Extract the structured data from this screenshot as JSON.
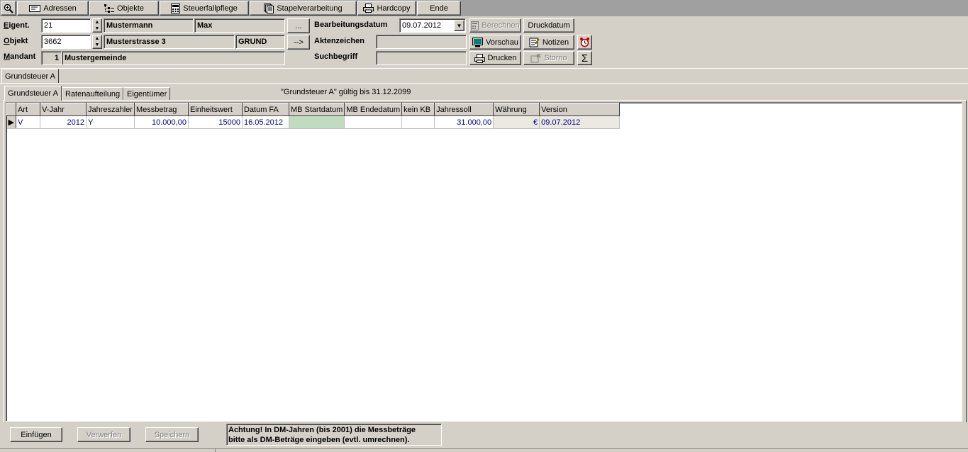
{
  "toolbar": {
    "items": [
      {
        "label": "Adressen",
        "icon": "address-card-icon"
      },
      {
        "label": "Objekte",
        "icon": "tree-list-icon"
      },
      {
        "label": "Steuerfallpflege",
        "icon": "calculator-icon"
      },
      {
        "label": "Stapelverarbeitung",
        "icon": "document-stack-icon"
      },
      {
        "label": "Hardcopy",
        "icon": "printer-icon"
      },
      {
        "label": "Ende",
        "icon": ""
      }
    ],
    "zoom_icon": "magnifier-icon"
  },
  "form": {
    "eigent_label": "Eigent.",
    "eigent_id": "21",
    "eigent_name": "Mustermann",
    "eigent_vorname": "Max",
    "objekt_label": "Objekt",
    "objekt_id": "3662",
    "objekt_address": "Musterstrasse 3",
    "objekt_type": "GRUND",
    "mandant_label": "Mandant",
    "mandant_id": "1",
    "mandant_name": "Mustergemeinde",
    "dots_button": "...",
    "arrow_button": "-->",
    "bearbeitungsdatum_label": "Bearbeitungsdatum",
    "bearbeitungsdatum_value": "09.07.2012",
    "aktenzeichen_label": "Aktenzeichen",
    "aktenzeichen_value": "",
    "suchbegriff_label": "Suchbegriff",
    "suchbegriff_value": ""
  },
  "actions": {
    "berechnen": "Berechnen",
    "druckdatum": "Druckdatum",
    "vorschau": "Vorschau",
    "notizen": "Notizen",
    "drucken": "Drucken",
    "storno": "Storno",
    "sum_symbol": "Σ"
  },
  "outer_tab": "Grundsteuer A",
  "inner_tabs": [
    "Grundsteuer A",
    "Ratenaufteilung",
    "Eigentümer"
  ],
  "validity_note": "\"Grundsteuer A\" gültig bis 31.12.2099",
  "grid": {
    "columns": [
      "Art",
      "V-Jahr",
      "Jahreszahler",
      "Messbetrag",
      "Einheitswert",
      "Datum FA",
      "MB Startdatum",
      "MB Endedatum",
      "kein KB",
      "Jahressoll",
      "Währung",
      "Version"
    ],
    "rows": [
      [
        "V",
        "2012",
        "Y",
        "10.000,00",
        "15000",
        "16.05.2012",
        "",
        "",
        "",
        "31.000,00",
        "€",
        "09.07.2012"
      ]
    ]
  },
  "bottom": {
    "einfuegen": "Einfügen",
    "verwerfen": "Verwerfen",
    "speichern": "Speichern",
    "warning_line1": "Achtung! In DM-Jahren (bis 2001) die Messbeträge",
    "warning_line2": "bitte als DM-Beträge eingeben (evtl. umrechnen)."
  },
  "colors": {
    "toolbar_bg": "#a0a0a0",
    "face": "#d4d0c8",
    "grid_text": "#000080",
    "startdatum_cell": "#c0dcc0"
  }
}
